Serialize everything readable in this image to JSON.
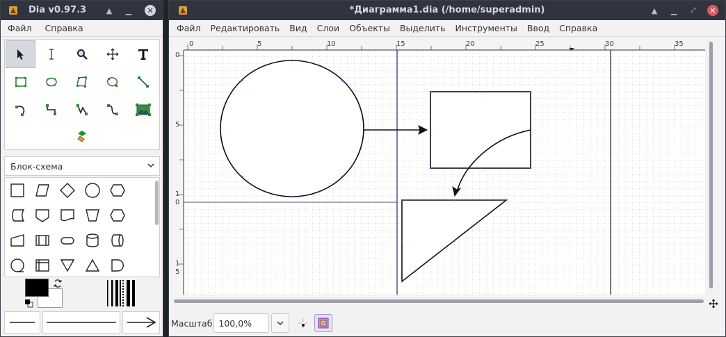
{
  "toolbox": {
    "title": "Dia v0.97.3",
    "menu": [
      "Файл",
      "Справка"
    ],
    "sheet": "Блок-схема"
  },
  "diagram": {
    "title": "*Диаграмма1.dia (/home/superadmin)",
    "menu": [
      "Файл",
      "Редактировать",
      "Вид",
      "Слои",
      "Объекты",
      "Выделить",
      "Инструменты",
      "Ввод",
      "Справка"
    ],
    "ruler_h": [
      "0",
      "5",
      "10",
      "15",
      "20",
      "25",
      "30",
      "35"
    ],
    "ruler_v": [
      "0",
      "5",
      "1",
      "0",
      "1",
      "5"
    ],
    "zoom_label": "Масштаб",
    "zoom_value": "100,0%"
  },
  "colors": {
    "titlebar": "#2f343f",
    "close_red": "#e0575b",
    "foreground": "#000000",
    "background": "#ffffff"
  }
}
